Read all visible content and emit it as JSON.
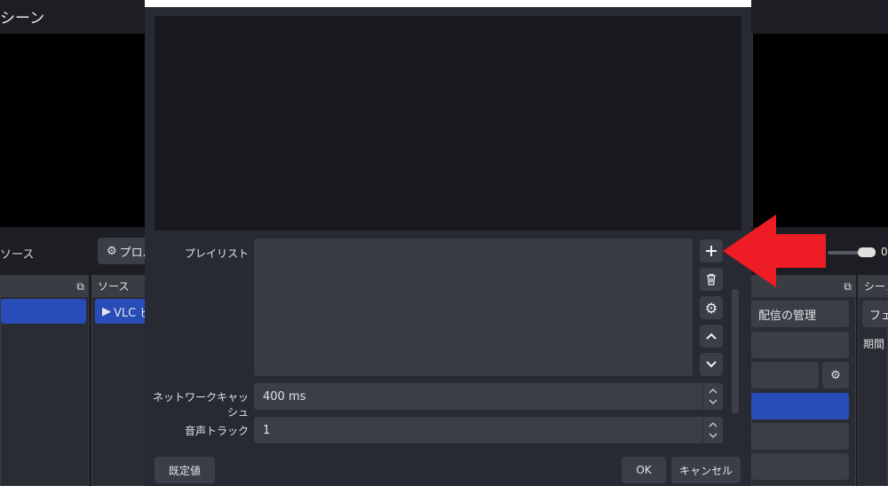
{
  "background": {
    "scene_title": "シーン",
    "source_left_label": "ソース",
    "properties_button": "プロパ",
    "sources_dock_title": "ソース",
    "source_item": "VLC ビ",
    "stream_manage_button": "配信の管理",
    "transition_dock_title": "シーン",
    "transition_select": "フェ",
    "duration_label": "期間",
    "volume_value": "0"
  },
  "dialog": {
    "playlist_label": "プレイリスト",
    "network_cache_label": "ネットワークキャッシュ",
    "network_cache_value": "400 ms",
    "audio_track_label": "音声トラック",
    "audio_track_value": "1",
    "defaults_button": "既定値",
    "ok_button": "OK",
    "cancel_button": "キャンセル"
  },
  "icons": {
    "add": "plus-icon",
    "remove": "trash-icon",
    "config": "gear-icon",
    "up": "chevron-up-icon",
    "down": "chevron-down-icon",
    "annotation": "red-arrow"
  },
  "colors": {
    "accent": "#284cb8",
    "annotation": "#ee1c24"
  }
}
